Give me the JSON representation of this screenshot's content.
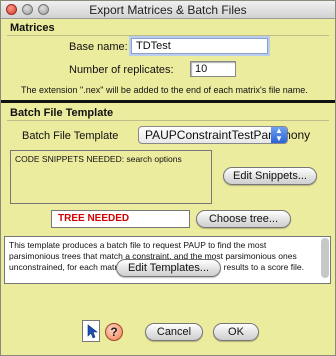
{
  "window": {
    "title": "Export Matrices & Batch Files"
  },
  "matrices": {
    "heading": "Matrices",
    "base_name_label": "Base name:",
    "base_name_value": "TDTest",
    "replicates_label": "Number of replicates:",
    "replicates_value": "10",
    "note": "The extension \".nex\" will be added to the end of each matrix's file name."
  },
  "batch": {
    "heading": "Batch File Template",
    "template_label": "Batch File Template",
    "template_selected": "PAUPConstraintTestParsimony",
    "snippets_text": "CODE SNIPPETS NEEDED: search options",
    "edit_snippets_label": "Edit Snippets...",
    "tree_needed_text": "TREE NEEDED",
    "choose_tree_label": "Choose tree...",
    "description": "This template produces a batch file to request PAUP to find the most parsimonious trees that match a constraint, and the most parsimonious ones unconstrained, for each matrix.  It asks PAUP to write the results to a score file.",
    "edit_templates_label": "Edit Templates..."
  },
  "footer": {
    "cancel_label": "Cancel",
    "ok_label": "OK",
    "help_glyph": "?"
  },
  "colors": {
    "panel_bg": "#ecec9f",
    "tree_needed": "#d20000"
  }
}
